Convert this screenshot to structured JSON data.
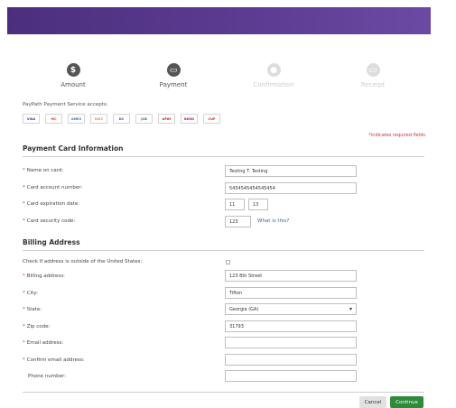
{
  "steps": [
    {
      "label": "Amount",
      "icon": "dollar-icon",
      "glyph": "$"
    },
    {
      "label": "Payment",
      "icon": "card-icon",
      "glyph": "▭"
    },
    {
      "label": "Confirmation",
      "icon": "thumbs-up-icon",
      "glyph": "●"
    },
    {
      "label": "Receipt",
      "icon": "receipt-icon",
      "glyph": "▭"
    }
  ],
  "accepts_text": "PayPath Payment Service accepts:",
  "cards": [
    {
      "name": "VISA",
      "color": "#1a3f8f"
    },
    {
      "name": "MC",
      "color": "#e8381d"
    },
    {
      "name": "AMEX",
      "color": "#2a79c6"
    },
    {
      "name": "DISC",
      "color": "#f08a24"
    },
    {
      "name": "DC",
      "color": "#2456a8"
    },
    {
      "name": "JCB",
      "color": "#137a3f"
    },
    {
      "name": "UPAY",
      "color": "#c21b2d"
    },
    {
      "name": "BKRD",
      "color": "#c21b2d"
    },
    {
      "name": "CUP",
      "color": "#d8262c"
    }
  ],
  "required_note": "*indicates required fields",
  "payment_section": {
    "title": "Payment Card Information",
    "name_label": "Name on card:",
    "name_value": "Testing T. Testing",
    "account_label": "Card account number:",
    "account_value": "5454545454545454",
    "expiration_label": "Card expiration date:",
    "exp_month": "11",
    "exp_year": "13",
    "security_label": "Card security code:",
    "security_value": "123",
    "what_link": "What is this?"
  },
  "billing_section": {
    "title": "Billing Address",
    "outside_label": "Check if address is outside of the United States:",
    "address_label": "Billing address:",
    "address_value": "123 8th Street",
    "city_label": "City:",
    "city_value": "Tifton",
    "state_label": "State:",
    "state_value": "Georgia (GA)",
    "zip_label": "Zip code:",
    "zip_value": "31793",
    "email_label": "Email address:",
    "email_value": "",
    "confirm_email_label": "Confirm email address:",
    "confirm_email_value": "",
    "phone_label": "Phone number:",
    "phone_value": ""
  },
  "buttons": {
    "cancel": "Cancel",
    "continue": "Continue"
  },
  "colors": {
    "banner": "#5a3a8f",
    "required": "#cc3333",
    "continue_button": "#2e8b3a"
  }
}
